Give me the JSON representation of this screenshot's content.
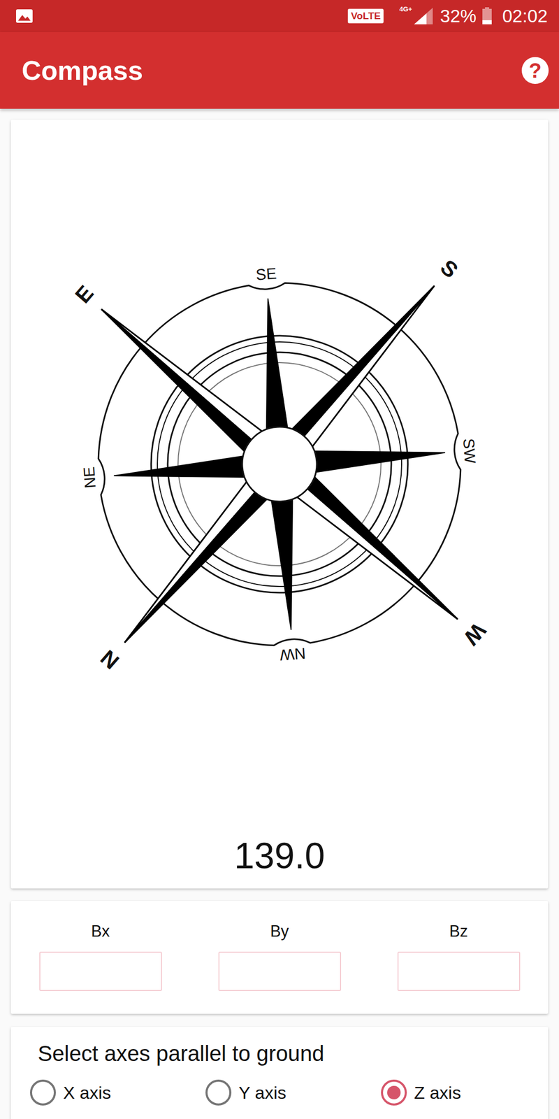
{
  "status_bar": {
    "badge": "VoLTE",
    "network": "4G+",
    "battery": "32%",
    "battery_level": 0.32,
    "time": "02:02"
  },
  "app_bar": {
    "title": "Compass",
    "help": "?"
  },
  "compass": {
    "labels": [
      "N",
      "NE",
      "E",
      "SE",
      "S",
      "SW",
      "W",
      "NW"
    ],
    "heading": "139.0"
  },
  "fields": [
    {
      "label": "Bx",
      "value": ""
    },
    {
      "label": "By",
      "value": ""
    },
    {
      "label": "Bz",
      "value": ""
    }
  ],
  "axis_select": {
    "title": "Select axes parallel to ground",
    "options": [
      {
        "label": "X axis",
        "selected": false
      },
      {
        "label": "Y axis",
        "selected": false
      },
      {
        "label": "Z axis",
        "selected": true
      }
    ]
  }
}
